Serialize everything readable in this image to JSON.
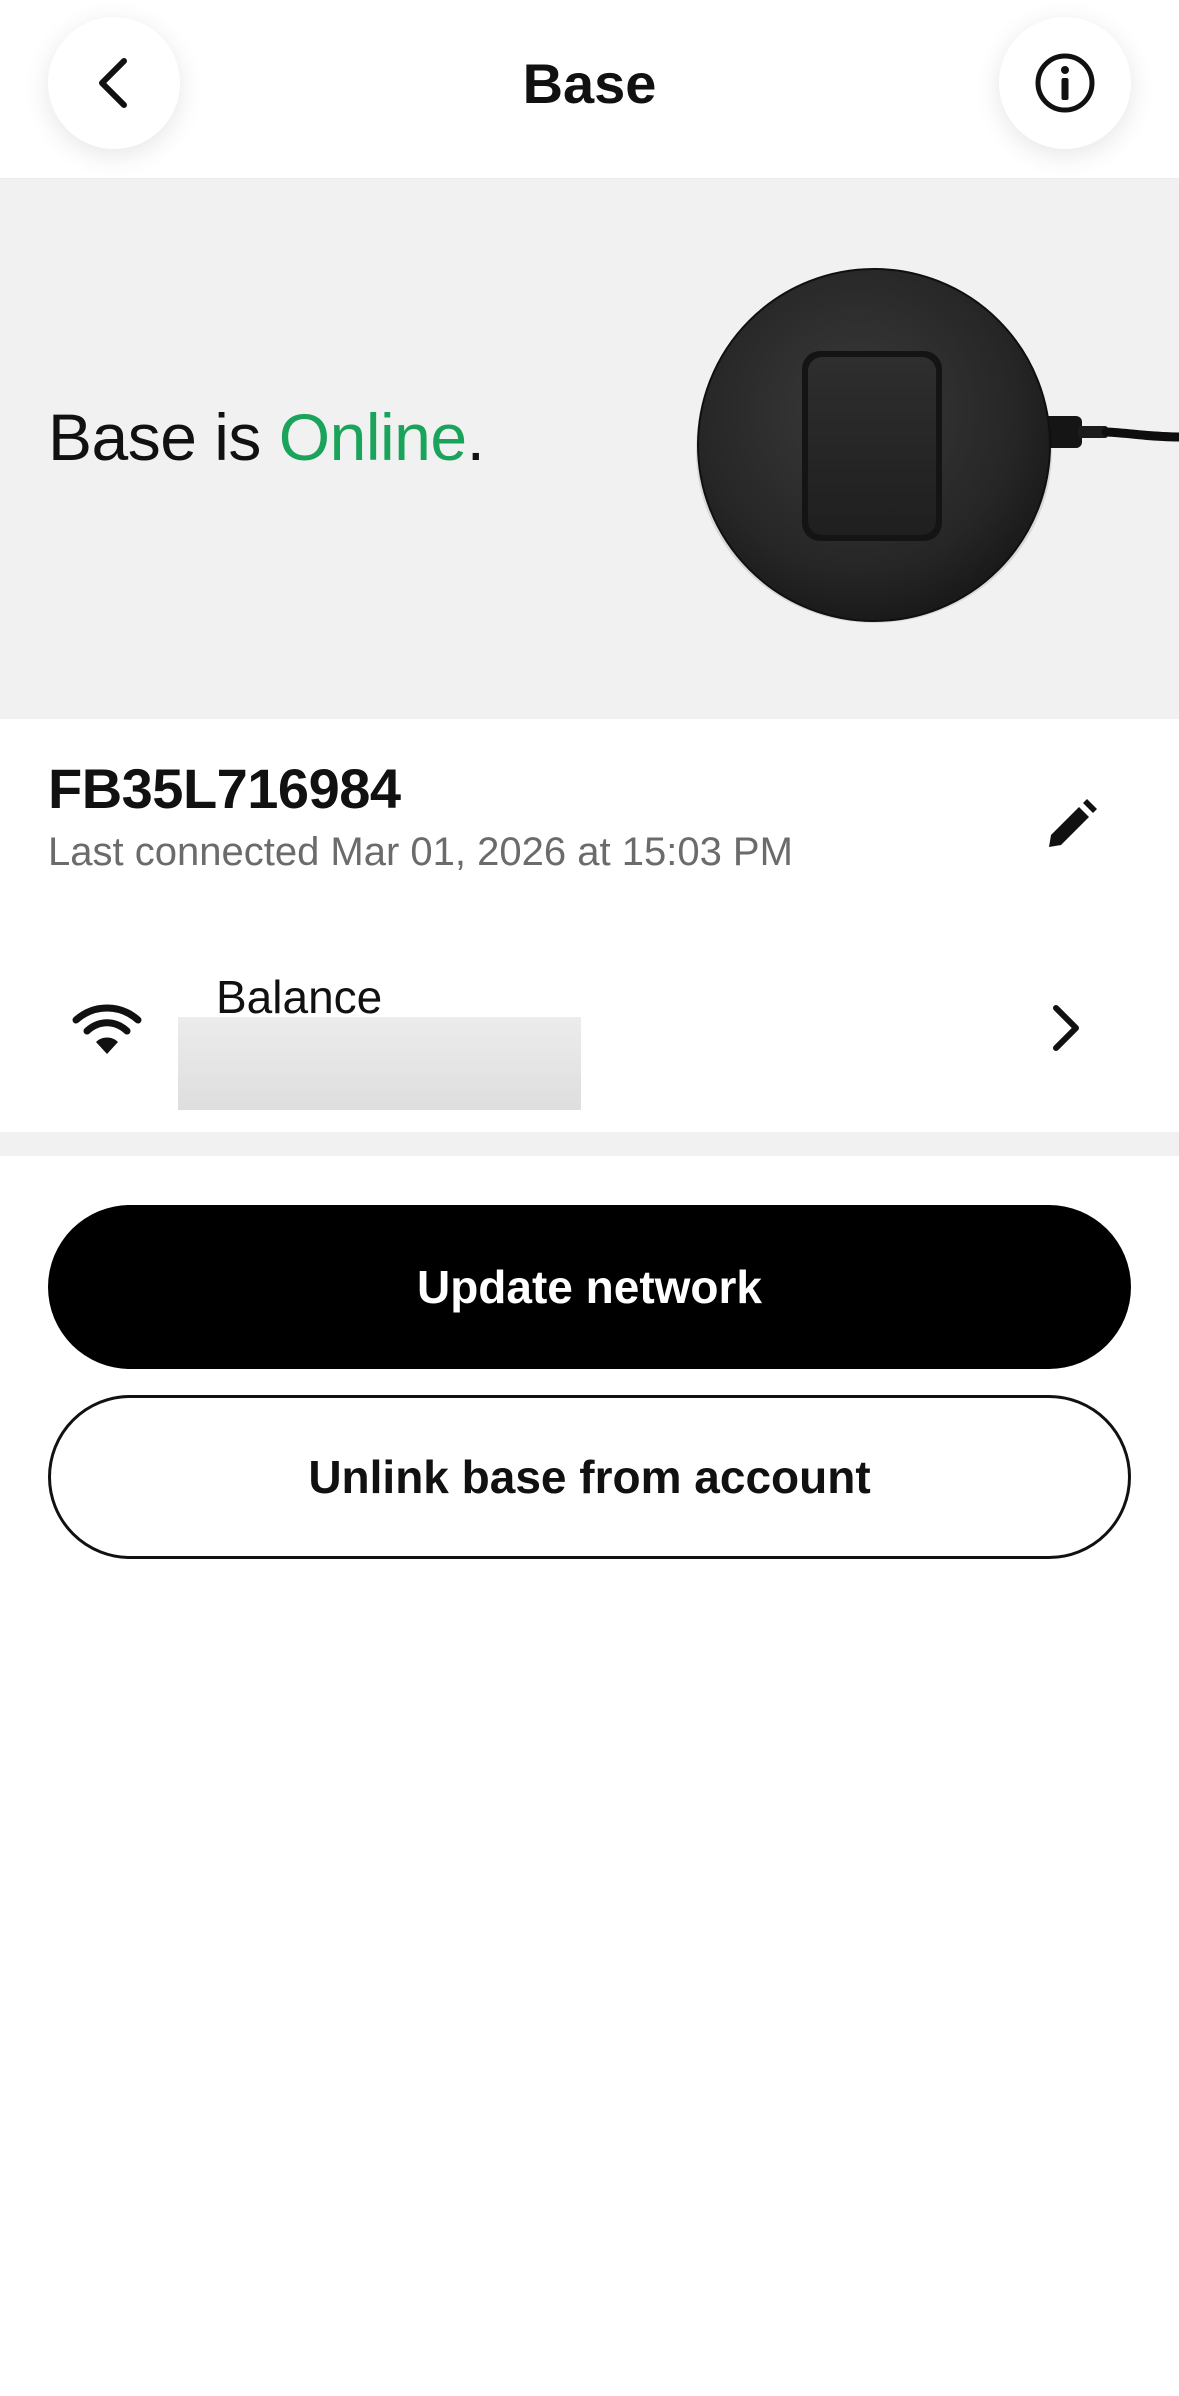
{
  "header": {
    "title": "Base",
    "back_icon": "chevron-left-icon",
    "info_icon": "info-icon"
  },
  "hero": {
    "status_prefix": "Base is ",
    "status_value": "Online",
    "status_suffix": ".",
    "status_color": "#1aa35a",
    "device_image": "base-device-image"
  },
  "device": {
    "id": "FB35L716984",
    "last_connected": "Last connected Mar 01, 2026 at 15:03 PM",
    "edit_icon": "pencil-icon"
  },
  "network": {
    "name": "Balance",
    "icon": "wifi-icon",
    "chevron_icon": "chevron-right-icon"
  },
  "actions": {
    "update_network": "Update network",
    "unlink": "Unlink base from account"
  }
}
